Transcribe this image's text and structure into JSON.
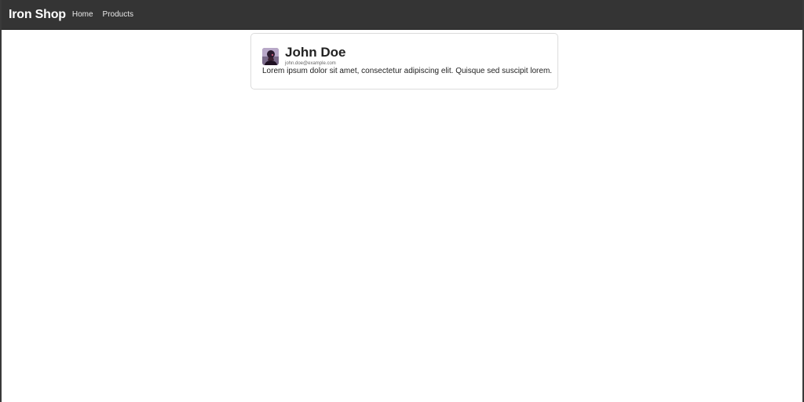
{
  "navbar": {
    "brand": "Iron Shop",
    "links": [
      {
        "label": "Home"
      },
      {
        "label": "Products"
      }
    ]
  },
  "profile": {
    "name": "John Doe",
    "email": "john.doe@example.com",
    "bio": "Lorem ipsum dolor sit amet, consectetur adipiscing elit. Quisque sed suscipit lorem.",
    "avatar_icon": "person-silhouette-icon"
  },
  "colors": {
    "navbar_bg": "#343434",
    "navbar_text": "#ffffff",
    "card_border": "#dcdcdc"
  }
}
